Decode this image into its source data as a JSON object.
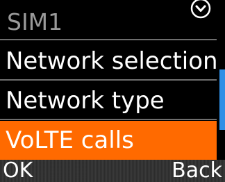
{
  "header": {
    "title": "SIM1",
    "icon": "chevron-down-circle-icon"
  },
  "menu": {
    "items": [
      {
        "label": "Network selection",
        "selected": false
      },
      {
        "label": "Network type",
        "selected": false
      },
      {
        "label": "VoLTE calls",
        "selected": true
      }
    ]
  },
  "scrollbar": {
    "position": 0.5,
    "visible_fraction": 0.5
  },
  "softkeys": {
    "left_label": "OK",
    "right_label": "Back"
  },
  "colors": {
    "selection": "#ff6a00",
    "scroll_thumb": "#2f8fe6",
    "header_text": "#9a9a9a",
    "background": "#000000"
  }
}
